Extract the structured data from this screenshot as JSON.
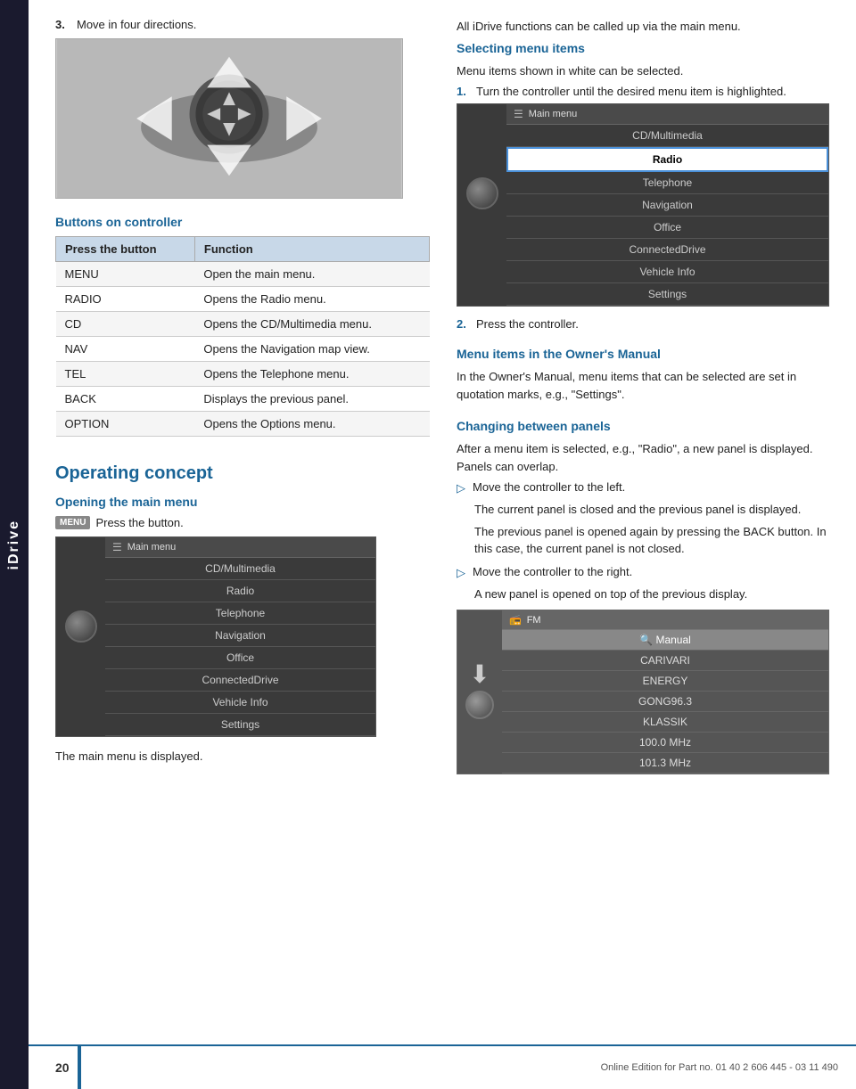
{
  "side_tab": {
    "label": "iDrive"
  },
  "left_col": {
    "step3": {
      "num": "3.",
      "text": "Move in four directions."
    },
    "buttons_section": {
      "heading": "Buttons on controller",
      "table_headers": [
        "Press the button",
        "Function"
      ],
      "rows": [
        {
          "button": "MENU",
          "function": "Open the main menu."
        },
        {
          "button": "RADIO",
          "function": "Opens the Radio menu."
        },
        {
          "button": "CD",
          "function": "Opens the CD/Multimedia menu."
        },
        {
          "button": "NAV",
          "function": "Opens the Navigation map view."
        },
        {
          "button": "TEL",
          "function": "Opens the Telephone menu."
        },
        {
          "button": "BACK",
          "function": "Displays the previous panel."
        },
        {
          "button": "OPTION",
          "function": "Opens the Options menu."
        }
      ]
    },
    "operating_concept": {
      "heading": "Operating concept",
      "opening_main_menu": {
        "subheading": "Opening the main menu",
        "menu_badge": "MENU",
        "instruction": "Press the button.",
        "screen": {
          "header_icon": "☰",
          "header_label": "Main menu",
          "items": [
            {
              "label": "CD/Multimedia",
              "state": "normal"
            },
            {
              "label": "Radio",
              "state": "normal"
            },
            {
              "label": "Telephone",
              "state": "normal"
            },
            {
              "label": "Navigation",
              "state": "normal"
            },
            {
              "label": "Office",
              "state": "normal"
            },
            {
              "label": "ConnectedDrive",
              "state": "normal"
            },
            {
              "label": "Vehicle Info",
              "state": "normal"
            },
            {
              "label": "Settings",
              "state": "normal"
            }
          ]
        },
        "caption": "The main menu is displayed."
      }
    }
  },
  "right_col": {
    "intro_text": "All iDrive functions can be called up via the main menu.",
    "selecting_menu_items": {
      "heading": "Selecting menu items",
      "intro": "Menu items shown in white can be selected.",
      "step1": {
        "num": "1.",
        "text": "Turn the controller until the desired menu item is highlighted."
      },
      "screen": {
        "header_icon": "☰",
        "header_label": "Main menu",
        "items": [
          {
            "label": "CD/Multimedia",
            "state": "normal"
          },
          {
            "label": "Radio",
            "state": "highlighted"
          },
          {
            "label": "Telephone",
            "state": "normal"
          },
          {
            "label": "Navigation",
            "state": "normal"
          },
          {
            "label": "Office",
            "state": "normal"
          },
          {
            "label": "ConnectedDrive",
            "state": "normal"
          },
          {
            "label": "Vehicle Info",
            "state": "normal"
          },
          {
            "label": "Settings",
            "state": "normal"
          }
        ]
      },
      "step2": {
        "num": "2.",
        "text": "Press the controller."
      }
    },
    "menu_items_owner_manual": {
      "heading": "Menu items in the Owner's Manual",
      "text": "In the Owner's Manual, menu items that can be selected are set in quotation marks, e.g., \"Settings\"."
    },
    "changing_panels": {
      "heading": "Changing between panels",
      "intro": "After a menu item is selected, e.g., \"Radio\", a new panel is displayed. Panels can overlap.",
      "bullet1": {
        "arrow": "▷",
        "text": "Move the controller to the left."
      },
      "bullet1_sub1": "The current panel is closed and the previous panel is displayed.",
      "bullet1_sub2": "The previous panel is opened again by pressing the BACK button. In this case, the current panel is not closed.",
      "bullet2": {
        "arrow": "▷",
        "text": "Move the controller to the right."
      },
      "bullet2_sub1": "A new panel is opened on top of the previous display.",
      "fm_screen": {
        "header_icon": "📻",
        "header_label": "FM",
        "items": [
          {
            "label": "🔍  Manual",
            "state": "highlight"
          },
          {
            "label": "CARIVARI",
            "state": "normal"
          },
          {
            "label": "ENERGY",
            "state": "normal"
          },
          {
            "label": "GONG96.3",
            "state": "normal"
          },
          {
            "label": "KLASSIK",
            "state": "normal"
          },
          {
            "label": "100.0  MHz",
            "state": "normal"
          },
          {
            "label": "101.3  MHz",
            "state": "normal"
          }
        ]
      }
    }
  },
  "footer": {
    "page_number": "20",
    "edition_text": "Online Edition for Part no. 01 40 2 606 445 - 03 11 490"
  }
}
